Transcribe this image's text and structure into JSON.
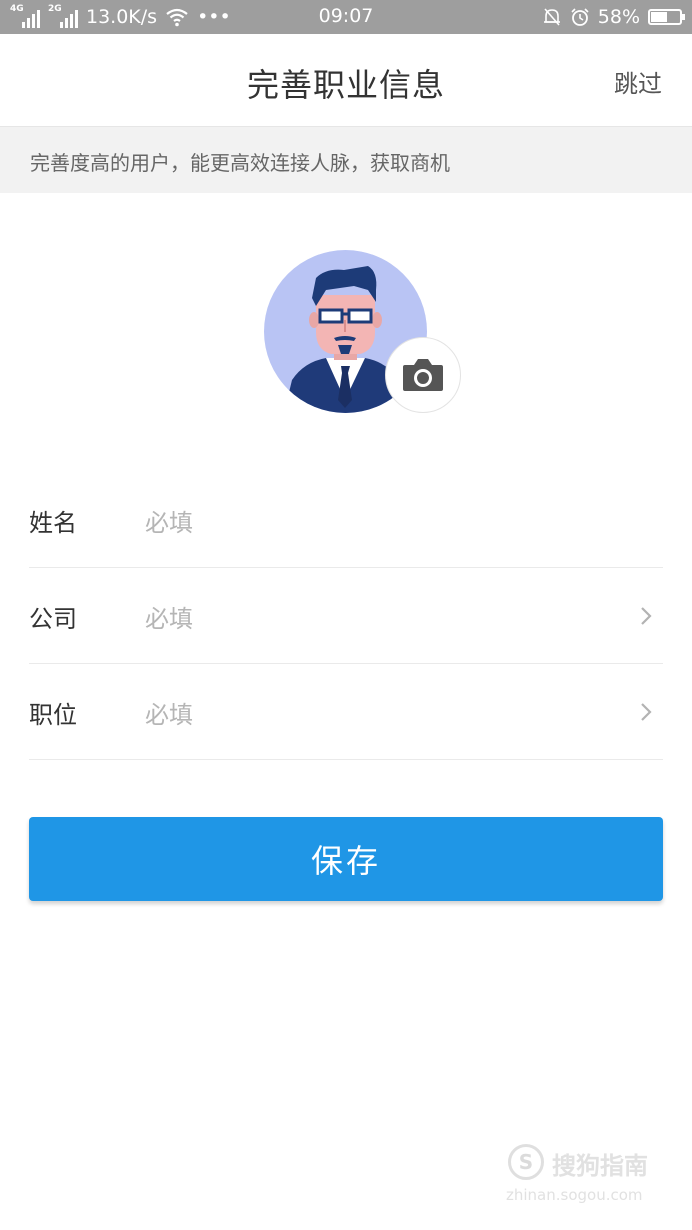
{
  "status_bar": {
    "net1": "4G",
    "net2": "2G",
    "speed": "13.0K/s",
    "more": "•••",
    "time": "09:07",
    "battery": "58%",
    "battery_level": 0.58,
    "icons": [
      "signal-icon",
      "wifi-icon",
      "silent-bell-icon",
      "alarm-icon",
      "battery-icon"
    ]
  },
  "header": {
    "title": "完善职业信息",
    "skip": "跳过"
  },
  "tip": "完善度高的用户，能更高效连接人脉，获取商机",
  "avatar": {
    "icon": "default-avatar-illustration",
    "camera_icon": "camera-icon",
    "colors": {
      "background": "#b9c4f4",
      "suit": "#1f3a79",
      "hair": "#1d3b78",
      "skin": "#f3b5b4"
    }
  },
  "form": {
    "rows": [
      {
        "label": "姓名",
        "placeholder": "必填",
        "has_arrow": false
      },
      {
        "label": "公司",
        "placeholder": "必填",
        "has_arrow": true
      },
      {
        "label": "职位",
        "placeholder": "必填",
        "has_arrow": true
      }
    ]
  },
  "save_button": {
    "label": "保存",
    "color": "#1f96e6"
  },
  "watermark": {
    "name": "搜狗指南",
    "url": "zhinan.sogou.com"
  }
}
